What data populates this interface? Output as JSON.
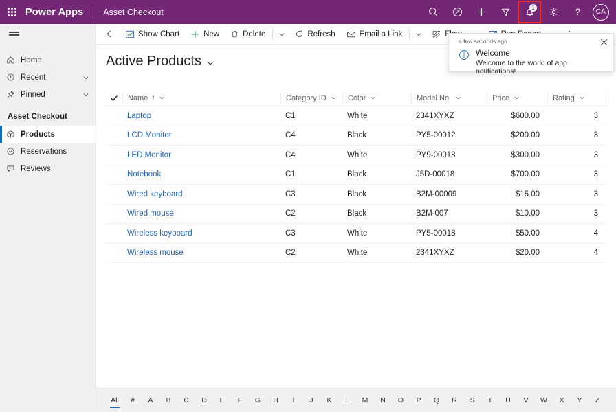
{
  "topbar": {
    "waffle_label": "waffle",
    "brand": "Power Apps",
    "app_name": "Asset Checkout",
    "search_label": "Search",
    "assistant_label": "Assistant",
    "new_label": "New",
    "filter_label": "Filter",
    "notifications_label": "Notifications",
    "notification_count": "1",
    "settings_label": "Settings",
    "help_label": "Help",
    "avatar_initials": "CA",
    "brand_color": "#742774",
    "highlight_color": "#ef3124"
  },
  "sidebar": {
    "menu_label": "Site map",
    "items": [
      {
        "label": "Home",
        "icon": "home-icon",
        "chevron": false
      },
      {
        "label": "Recent",
        "icon": "clock-icon",
        "chevron": true
      },
      {
        "label": "Pinned",
        "icon": "pin-icon",
        "chevron": true
      }
    ],
    "group_title": "Asset Checkout",
    "group_items": [
      {
        "label": "Products",
        "icon": "box-icon",
        "selected": true
      },
      {
        "label": "Reservations",
        "icon": "check-circle-icon",
        "selected": false
      },
      {
        "label": "Reviews",
        "icon": "comment-icon",
        "selected": false
      }
    ],
    "selected_accent": "#0f6cbd"
  },
  "commandbar": {
    "back_label": "Back",
    "items": [
      {
        "label": "Show Chart",
        "icon": "chart-icon",
        "chevron": false
      },
      {
        "label": "New",
        "icon": "plus-icon",
        "chevron": false
      },
      {
        "label": "Delete",
        "icon": "trash-icon",
        "chevron": true
      },
      {
        "label": "Refresh",
        "icon": "refresh-icon",
        "chevron": false
      },
      {
        "label": "Email a Link",
        "icon": "email-link-icon",
        "chevron": true
      },
      {
        "label": "Flow",
        "icon": "flow-icon",
        "chevron": true
      },
      {
        "label": "Run Report",
        "icon": "report-icon",
        "chevron": true
      }
    ],
    "overflow_label": "More commands"
  },
  "view": {
    "title": "Active Products",
    "chevron_label": "Change view"
  },
  "grid": {
    "select_all_label": "Select all",
    "columns": [
      {
        "label": "Name",
        "sorted": true,
        "sort_arrow": "↑",
        "align": "left"
      },
      {
        "label": "Category ID",
        "sorted": false,
        "sort_arrow": "",
        "align": "left"
      },
      {
        "label": "Color",
        "sorted": false,
        "sort_arrow": "",
        "align": "left"
      },
      {
        "label": "Model No.",
        "sorted": false,
        "sort_arrow": "",
        "align": "left"
      },
      {
        "label": "Price",
        "sorted": false,
        "sort_arrow": "",
        "align": "left"
      },
      {
        "label": "Rating",
        "sorted": false,
        "sort_arrow": "",
        "align": "left"
      }
    ],
    "rows": [
      {
        "name": "Laptop",
        "category": "C1",
        "color": "White",
        "model": "2341XYXZ",
        "price": "$600.00",
        "rating": "3"
      },
      {
        "name": "LCD Monitor",
        "category": "C4",
        "color": "Black",
        "model": "PY5-00012",
        "price": "$200.00",
        "rating": "3"
      },
      {
        "name": "LED Monitor",
        "category": "C4",
        "color": "White",
        "model": "PY9-00018",
        "price": "$300.00",
        "rating": "3"
      },
      {
        "name": "Notebook",
        "category": "C1",
        "color": "Black",
        "model": "J5D-00018",
        "price": "$700.00",
        "rating": "3"
      },
      {
        "name": "Wired keyboard",
        "category": "C3",
        "color": "Black",
        "model": "B2M-00009",
        "price": "$15.00",
        "rating": "3"
      },
      {
        "name": "Wired mouse",
        "category": "C2",
        "color": "Black",
        "model": "B2M-007",
        "price": "$10.00",
        "rating": "3"
      },
      {
        "name": "Wireless keyboard",
        "category": "C3",
        "color": "White",
        "model": "PY5-00018",
        "price": "$50.00",
        "rating": "4"
      },
      {
        "name": "Wireless mouse",
        "category": "C2",
        "color": "White",
        "model": "2341XYXZ",
        "price": "$20.00",
        "rating": "4"
      }
    ],
    "link_color": "#2266bb"
  },
  "alphabar": {
    "active": "All",
    "letters": [
      "All",
      "#",
      "A",
      "B",
      "C",
      "D",
      "E",
      "F",
      "G",
      "H",
      "I",
      "J",
      "K",
      "L",
      "M",
      "N",
      "O",
      "P",
      "Q",
      "R",
      "S",
      "T",
      "U",
      "V",
      "W",
      "X",
      "Y",
      "Z"
    ]
  },
  "notification": {
    "time": "a few seconds ago",
    "close_label": "Close",
    "icon": "info-icon",
    "title": "Welcome",
    "message": "Welcome to the world of app notifications!"
  }
}
